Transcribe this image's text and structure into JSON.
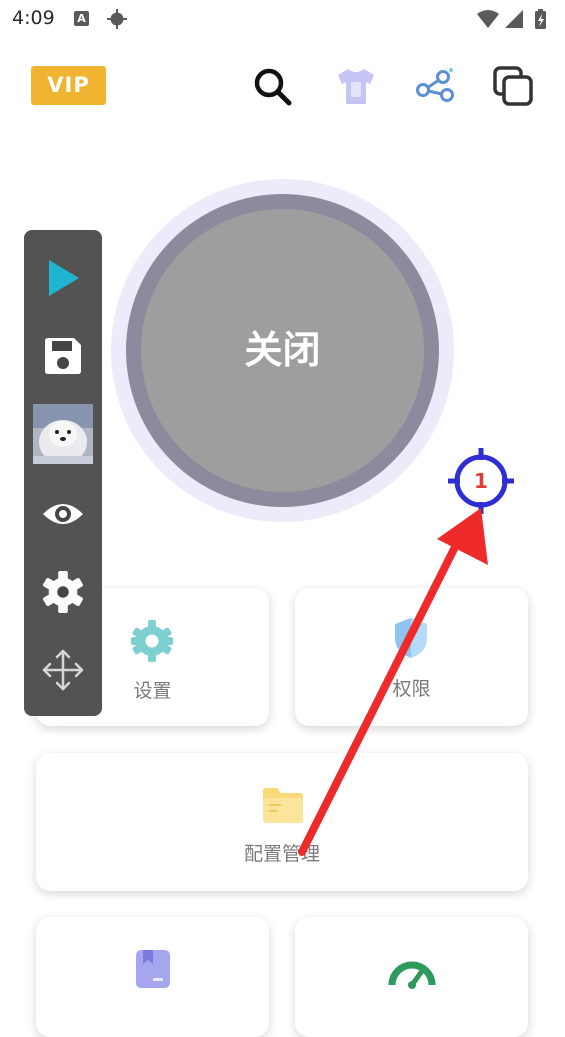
{
  "status_bar": {
    "time": "4:09",
    "notification_icon": "A"
  },
  "header": {
    "vip_label": "VIP",
    "icons": [
      "search-icon",
      "tshirt-icon",
      "share-icon",
      "copy-icon"
    ]
  },
  "power_button": {
    "label": "关闭"
  },
  "cards": {
    "settings_label": "设置",
    "permissions_label": "权限",
    "config_label": "配置管理"
  },
  "floating_toolbar": {
    "items": [
      "play-icon",
      "save-icon",
      "thumbnail",
      "eye-icon",
      "gear-icon",
      "move-icon"
    ]
  },
  "overlay": {
    "crosshair_number": "1",
    "colors": {
      "crosshair": "#2e2ed1",
      "arrow": "#ee2a2a"
    }
  },
  "colors": {
    "vip": "#f0b431",
    "teal": "#7ecfd0",
    "accent_play": "#1fb5d0"
  }
}
